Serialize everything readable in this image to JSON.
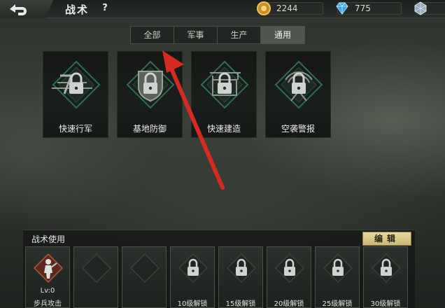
{
  "header": {
    "title": "战术",
    "help_label": "?",
    "gold": "2244",
    "diamonds": "775",
    "back_icon": "back-arrow-icon"
  },
  "tabs": [
    {
      "label": "全部",
      "active": false
    },
    {
      "label": "军事",
      "active": false
    },
    {
      "label": "生产",
      "active": false
    },
    {
      "label": "通用",
      "active": true
    }
  ],
  "tactics": [
    {
      "label": "快速行军",
      "icon": "march-icon",
      "locked": true
    },
    {
      "label": "基地防御",
      "icon": "shield-icon",
      "locked": true
    },
    {
      "label": "快速建造",
      "icon": "building-icon",
      "locked": true
    },
    {
      "label": "空袭警报",
      "icon": "radar-icon",
      "locked": true
    }
  ],
  "panel": {
    "title": "战术使用",
    "edit_label": "编辑"
  },
  "slots": [
    {
      "kind": "active",
      "level": "Lv:0",
      "name": "步兵攻击",
      "icon": "soldier-icon"
    },
    {
      "kind": "empty"
    },
    {
      "kind": "empty"
    },
    {
      "kind": "locked",
      "unlock": "10级解锁"
    },
    {
      "kind": "locked",
      "unlock": "15级解锁"
    },
    {
      "kind": "locked",
      "unlock": "20级解锁"
    },
    {
      "kind": "locked",
      "unlock": "25级解锁"
    },
    {
      "kind": "locked",
      "unlock": "30级解锁"
    }
  ],
  "colors": {
    "accent": "#c9b676",
    "arrow": "#d52a22",
    "card_outline": "#2f6b55"
  }
}
